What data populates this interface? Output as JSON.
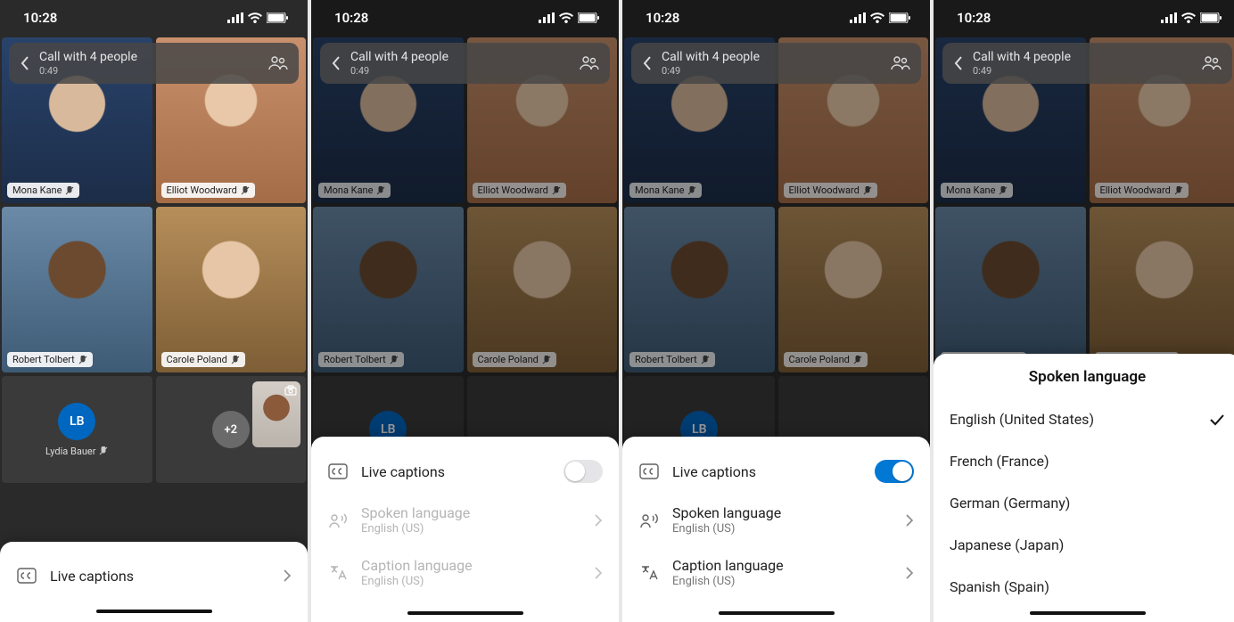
{
  "statusBar": {
    "time": "10:28"
  },
  "header": {
    "title": "Call with 4 people",
    "duration": "0:49"
  },
  "participants": {
    "p1": "Mona Kane",
    "p2": "Elliot Woodward",
    "p3": "Robert Tolbert",
    "p4": "Carole Poland",
    "audio1_name": "Lydia Bauer",
    "audio1_initials": "LB",
    "overflow": "+2"
  },
  "captions": {
    "label": "Live captions",
    "spoken_label": "Spoken language",
    "spoken_value": "English (US)",
    "caption_label": "Caption language",
    "caption_value": "English (US)"
  },
  "spokenLanguageSheet": {
    "title": "Spoken language",
    "options": {
      "o1": "English (United States)",
      "o2": "French (France)",
      "o3": "German (Germany)",
      "o4": "Japanese (Japan)",
      "o5": "Spanish (Spain)"
    }
  }
}
